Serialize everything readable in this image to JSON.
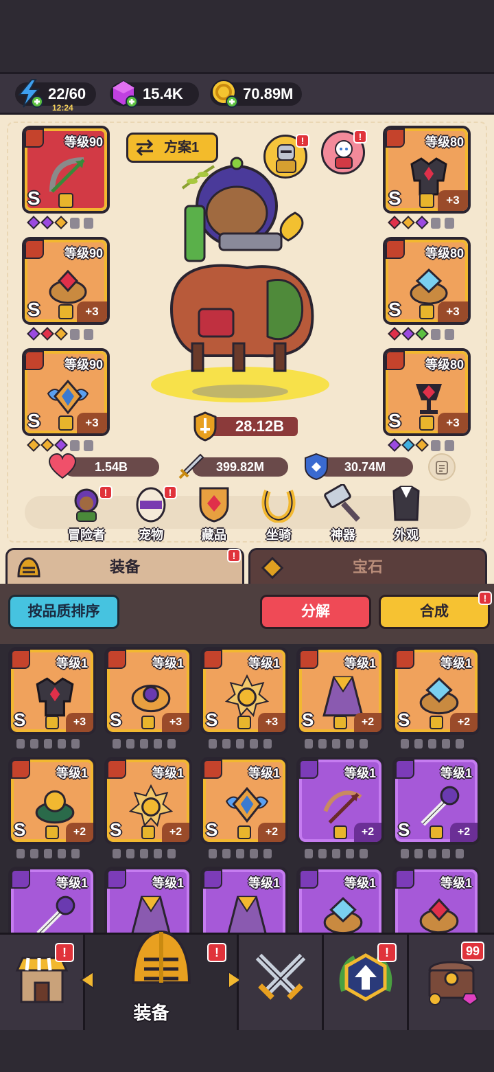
{
  "resources": {
    "energy": {
      "value": "22/60",
      "timer": "12:24",
      "icon": "lightning-icon"
    },
    "gems": {
      "value": "15.4K",
      "icon": "purple-gem-icon"
    },
    "gold": {
      "value": "70.89M",
      "icon": "gold-coin-icon"
    }
  },
  "plan": {
    "label": "方案1"
  },
  "slots_left": [
    {
      "level": "等级90",
      "grade": "S",
      "plus": "",
      "cat": "sword-icon",
      "item": "bow-icon",
      "rarity": "red",
      "gems": [
        "#9b4ae0",
        "#9b4ae0",
        "#f0b030"
      ]
    },
    {
      "level": "等级90",
      "grade": "S",
      "plus": "+3",
      "cat": "ring-icon",
      "item": "ruby-ring-icon",
      "rarity": "orange",
      "gems": [
        "#9b4ae0",
        "#e0304a",
        "#f0b030"
      ]
    },
    {
      "level": "等级90",
      "grade": "S",
      "plus": "+3",
      "cat": "necklace-icon",
      "item": "winged-amulet-icon",
      "rarity": "orange",
      "gems": [
        "#f0b030",
        "#f0b030",
        "#9b4ae0"
      ]
    }
  ],
  "slots_right": [
    {
      "level": "等级80",
      "grade": "S",
      "plus": "+3",
      "cat": "armor-icon",
      "item": "dark-armor-icon",
      "rarity": "orange",
      "gems": [
        "#e0304a",
        "#f0b030",
        "#9b4ae0"
      ]
    },
    {
      "level": "等级80",
      "grade": "S",
      "plus": "+3",
      "cat": "ring-icon",
      "item": "crystal-ring-icon",
      "rarity": "orange",
      "gems": [
        "#e0304a",
        "#9b4ae0",
        "#5cc040"
      ]
    },
    {
      "level": "等级80",
      "grade": "S",
      "plus": "+3",
      "cat": "necklace-icon",
      "item": "chalice-amulet-icon",
      "rarity": "orange",
      "gems": [
        "#9b4ae0",
        "#40b0e0",
        "#f0b030"
      ]
    }
  ],
  "power": {
    "value": "28.12B"
  },
  "stats": {
    "hp": "1.54B",
    "attack": "399.82M",
    "defense": "30.74M"
  },
  "menu": [
    {
      "label": "冒险者",
      "icon": "adventurer-icon",
      "badge": "!"
    },
    {
      "label": "宠物",
      "icon": "pet-egg-icon",
      "badge": "!"
    },
    {
      "label": "藏品",
      "icon": "collection-shield-icon",
      "badge": ""
    },
    {
      "label": "坐骑",
      "icon": "horseshoe-icon",
      "badge": ""
    },
    {
      "label": "神器",
      "icon": "hammer-icon",
      "badge": ""
    },
    {
      "label": "外观",
      "icon": "outfit-icon",
      "badge": ""
    }
  ],
  "tabs": {
    "equipment": "装备",
    "gems": "宝石",
    "badge": "!"
  },
  "buttons": {
    "sort": "按品质排序",
    "decompose": "分解",
    "synthesize": "合成",
    "badge": "!"
  },
  "inventory": [
    {
      "level": "等级1",
      "grade": "S",
      "plus": "+3",
      "rarity": "orange",
      "item": "dark-armor-icon"
    },
    {
      "level": "等级1",
      "grade": "S",
      "plus": "+3",
      "rarity": "orange",
      "item": "purple-ring-icon"
    },
    {
      "level": "等级1",
      "grade": "S",
      "plus": "+3",
      "rarity": "orange",
      "item": "sun-amulet-icon"
    },
    {
      "level": "等级1",
      "grade": "S",
      "plus": "+2",
      "rarity": "orange",
      "item": "purple-cloak-icon"
    },
    {
      "level": "等级1",
      "grade": "S",
      "plus": "+2",
      "rarity": "orange",
      "item": "crystal-ring-icon"
    },
    {
      "level": "等级1",
      "grade": "S",
      "plus": "+2",
      "rarity": "orange",
      "item": "amber-ring-icon"
    },
    {
      "level": "等级1",
      "grade": "S",
      "plus": "+2",
      "rarity": "orange",
      "item": "sun-amulet-icon"
    },
    {
      "level": "等级1",
      "grade": "S",
      "plus": "+2",
      "rarity": "orange",
      "item": "winged-amulet-icon"
    },
    {
      "level": "等级1",
      "grade": "",
      "plus": "+2",
      "rarity": "purple",
      "item": "crossbow-icon"
    },
    {
      "level": "等级1",
      "grade": "S",
      "plus": "+2",
      "rarity": "purple",
      "item": "staff-icon"
    },
    {
      "level": "等级1",
      "grade": "",
      "plus": "",
      "rarity": "purple",
      "item": "staff-icon"
    },
    {
      "level": "等级1",
      "grade": "",
      "plus": "",
      "rarity": "purple",
      "item": "purple-cloak-icon"
    },
    {
      "level": "等级1",
      "grade": "",
      "plus": "",
      "rarity": "purple",
      "item": "purple-cloak-icon"
    },
    {
      "level": "等级1",
      "grade": "",
      "plus": "",
      "rarity": "purple",
      "item": "crystal-ring-icon"
    },
    {
      "level": "等级1",
      "grade": "",
      "plus": "",
      "rarity": "purple",
      "item": "ruby-ring-icon"
    }
  ],
  "nav": {
    "shop": {
      "icon": "shop-icon",
      "badge": "!"
    },
    "equipment": {
      "label": "装备",
      "icon": "helmet-icon",
      "badge": "!"
    },
    "battle": {
      "icon": "crossed-swords-icon",
      "badge": ""
    },
    "upgrade": {
      "icon": "upgrade-arrow-icon",
      "badge": "!"
    },
    "chest": {
      "icon": "treasure-chest-icon",
      "badge": "99"
    }
  }
}
